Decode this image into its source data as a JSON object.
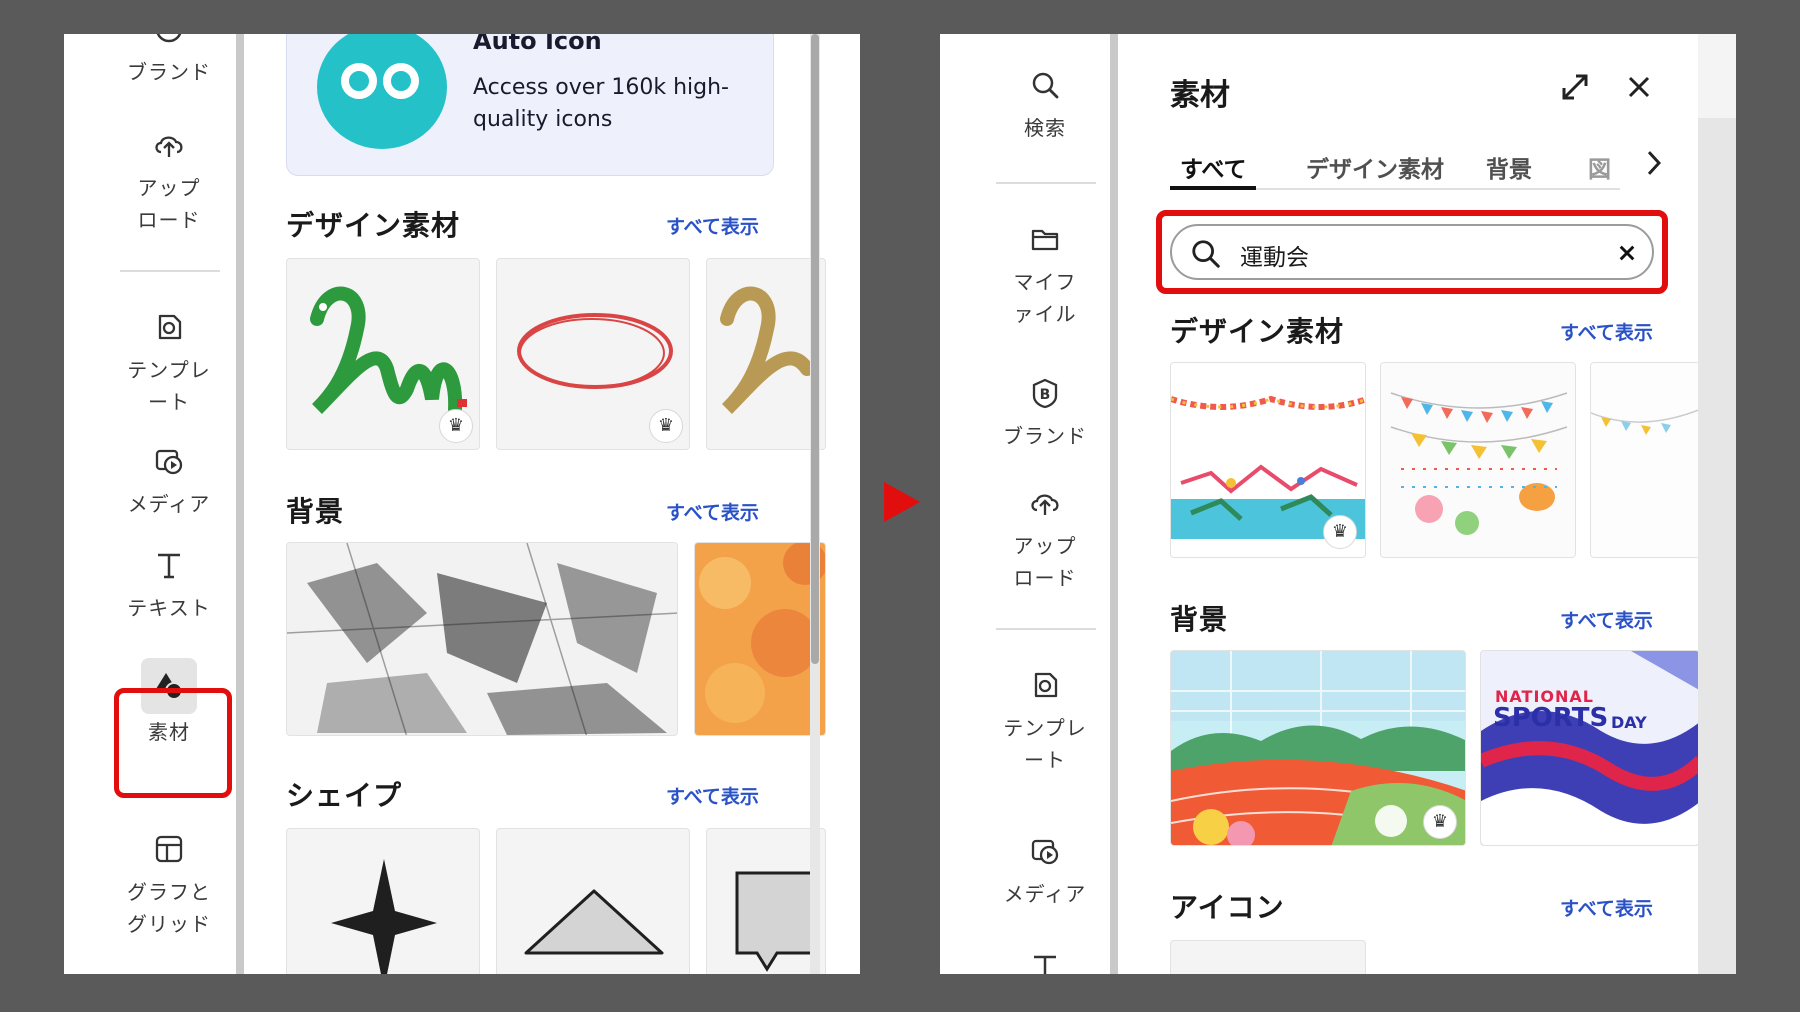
{
  "left": {
    "rail": {
      "brand": "ブランド",
      "upload": "アップロード",
      "template": "テンプレート",
      "media": "メディア",
      "text": "テキスト",
      "elements": "素材",
      "charts": "グラフとグリッド"
    },
    "promo": {
      "title": "Auto Icon",
      "line1": "Access over 160k high-",
      "line2": "quality icons"
    },
    "sections": {
      "design": {
        "title": "デザイン素材",
        "see_all": "すべて表示"
      },
      "background": {
        "title": "背景",
        "see_all": "すべて表示"
      },
      "shape": {
        "title": "シェイプ",
        "see_all": "すべて表示"
      }
    }
  },
  "right": {
    "rail": {
      "search": "検索",
      "my_files": "マイファイル",
      "brand": "ブランド",
      "upload": "アップロード",
      "template": "テンプレート",
      "media": "メディア"
    },
    "header": {
      "title": "素材"
    },
    "tabs": [
      "すべて",
      "デザイン素材",
      "背景",
      "図"
    ],
    "search": {
      "value": "運動会"
    },
    "sections": {
      "design": {
        "title": "デザイン素材",
        "see_all": "すべて表示"
      },
      "background": {
        "title": "背景",
        "see_all": "すべて表示"
      },
      "icons": {
        "title": "アイコン",
        "see_all": "すべて表示"
      }
    },
    "sports_banner": {
      "line1": "NATIONAL",
      "line2": "SPORTS",
      "line3": "DAY"
    }
  },
  "colors": {
    "highlight": "#e20d0d",
    "link": "#2a52c6",
    "frame": "#5a5a5a"
  }
}
